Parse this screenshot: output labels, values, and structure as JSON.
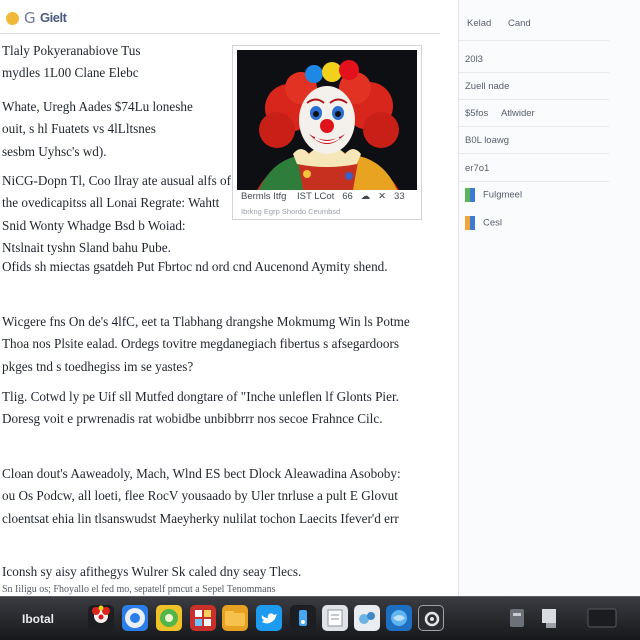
{
  "header": {
    "logo_symbol": "G",
    "logo_text": "Gielt"
  },
  "article": {
    "paragraphs": [
      [
        "Tlaly Pokyeranabiove Tus",
        "mydles 1L00 Clane Elebc"
      ],
      [
        "Whate, Uregh Aades $74Lu loneshe",
        "ouit, s hl Fuatets vs 4lLltsnes",
        "sesbm Uyhsc's wd)."
      ],
      [
        "NiCG-Dopn Tl, Coo Ilray ate ausual alfs of",
        "the ovedicapitss all Lonai Regrate: Wahtt",
        "Snid Wonty  Whadge Bsd b Woiad:",
        "Ntslnait tyshn Sland bahu Pube."
      ],
      [
        "Ofids sh miectas gsatdeh Put Fbrtoc nd ord   cnd Aucenond Aymity shend."
      ],
      [
        "Wicgere fns On de's 4lfC, eet ta Tlabhang drangshe Mokmumg Win ls Potme",
        "Thoa nos Plsite ealad. Ordegs tovitre megdanegiach fibertus s afsegardoors",
        "pkges tnd s toedhegiss im se yastes?"
      ],
      [
        "Tlig. Cotwd ly pe Uif sll Mutfed dongtare of \"Inche unleflen lf Glonts Pier.",
        "Doresg voit  e prwrenadis rat wobidbe unbibbrrr nos secoe Frahnce Cilc."
      ],
      [
        "Cloan dout's Aaweadoly, Mach, Wlnd ES bect Dlock Aleawadina Asoboby:",
        "ou Os Podcw, all loeti, flee RocV yousaado by Uler tnrluse a pult E Glovut",
        "cloentsat ehia lin tlsanswudst Maeyherky nulilat tochon Laecits Ifever'd err"
      ],
      [
        "Iconsh sy aisy afithegys Wulrer Sk caled dny seay Tlecs.",
        "Sn Iiligu os; Fhoyallo el fed mo, sepatelf pmcut a Sepel Tenommans"
      ]
    ]
  },
  "figure": {
    "caption_items": [
      "Bermls Itfg",
      "IST",
      "LCot",
      "66",
      "☁",
      "✕",
      "33"
    ],
    "subcaption": "Ibrkng Egrp  Shordo Ceumbsd"
  },
  "sidebar": {
    "head": [
      "Kelad",
      "Cand"
    ],
    "items": [
      "20l3",
      "Zuell nade",
      "$5fos",
      "Atlwider",
      "B0L loawg",
      "er7o1",
      "Fulgmeel",
      "Cesl"
    ]
  },
  "taskbar": {
    "start_label": "Ibotal",
    "apps": [
      "clown-app",
      "chrome",
      "safari",
      "media-player",
      "folder",
      "twitter",
      "music",
      "notes",
      "bird-app",
      "globe",
      "settings"
    ],
    "tray": [
      "volume",
      "battery",
      "desktop"
    ]
  },
  "colors": {
    "accent": "#4a5a7f",
    "taskbar": "#2a2b2f",
    "chart_green": "#5cb55b",
    "chart_blue": "#3a7bd5",
    "chart_orange": "#f2a33a"
  }
}
